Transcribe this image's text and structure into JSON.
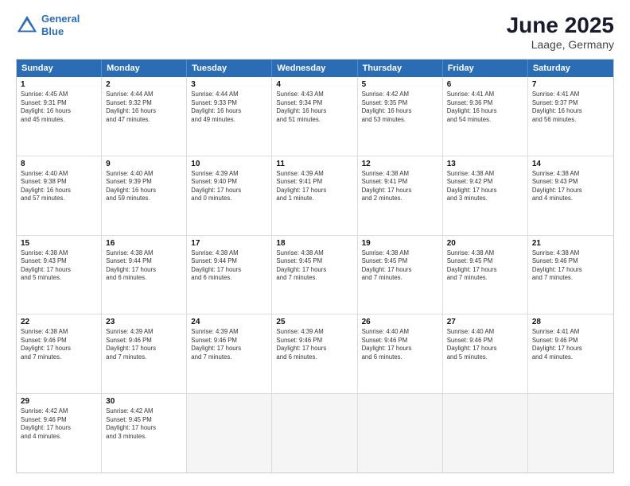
{
  "header": {
    "logo_line1": "General",
    "logo_line2": "Blue",
    "title": "June 2025",
    "location": "Laage, Germany"
  },
  "weekdays": [
    "Sunday",
    "Monday",
    "Tuesday",
    "Wednesday",
    "Thursday",
    "Friday",
    "Saturday"
  ],
  "rows": [
    [
      {
        "day": "1",
        "info": "Sunrise: 4:45 AM\nSunset: 9:31 PM\nDaylight: 16 hours\nand 45 minutes."
      },
      {
        "day": "2",
        "info": "Sunrise: 4:44 AM\nSunset: 9:32 PM\nDaylight: 16 hours\nand 47 minutes."
      },
      {
        "day": "3",
        "info": "Sunrise: 4:44 AM\nSunset: 9:33 PM\nDaylight: 16 hours\nand 49 minutes."
      },
      {
        "day": "4",
        "info": "Sunrise: 4:43 AM\nSunset: 9:34 PM\nDaylight: 16 hours\nand 51 minutes."
      },
      {
        "day": "5",
        "info": "Sunrise: 4:42 AM\nSunset: 9:35 PM\nDaylight: 16 hours\nand 53 minutes."
      },
      {
        "day": "6",
        "info": "Sunrise: 4:41 AM\nSunset: 9:36 PM\nDaylight: 16 hours\nand 54 minutes."
      },
      {
        "day": "7",
        "info": "Sunrise: 4:41 AM\nSunset: 9:37 PM\nDaylight: 16 hours\nand 56 minutes."
      }
    ],
    [
      {
        "day": "8",
        "info": "Sunrise: 4:40 AM\nSunset: 9:38 PM\nDaylight: 16 hours\nand 57 minutes."
      },
      {
        "day": "9",
        "info": "Sunrise: 4:40 AM\nSunset: 9:39 PM\nDaylight: 16 hours\nand 59 minutes."
      },
      {
        "day": "10",
        "info": "Sunrise: 4:39 AM\nSunset: 9:40 PM\nDaylight: 17 hours\nand 0 minutes."
      },
      {
        "day": "11",
        "info": "Sunrise: 4:39 AM\nSunset: 9:41 PM\nDaylight: 17 hours\nand 1 minute."
      },
      {
        "day": "12",
        "info": "Sunrise: 4:38 AM\nSunset: 9:41 PM\nDaylight: 17 hours\nand 2 minutes."
      },
      {
        "day": "13",
        "info": "Sunrise: 4:38 AM\nSunset: 9:42 PM\nDaylight: 17 hours\nand 3 minutes."
      },
      {
        "day": "14",
        "info": "Sunrise: 4:38 AM\nSunset: 9:43 PM\nDaylight: 17 hours\nand 4 minutes."
      }
    ],
    [
      {
        "day": "15",
        "info": "Sunrise: 4:38 AM\nSunset: 9:43 PM\nDaylight: 17 hours\nand 5 minutes."
      },
      {
        "day": "16",
        "info": "Sunrise: 4:38 AM\nSunset: 9:44 PM\nDaylight: 17 hours\nand 6 minutes."
      },
      {
        "day": "17",
        "info": "Sunrise: 4:38 AM\nSunset: 9:44 PM\nDaylight: 17 hours\nand 6 minutes."
      },
      {
        "day": "18",
        "info": "Sunrise: 4:38 AM\nSunset: 9:45 PM\nDaylight: 17 hours\nand 7 minutes."
      },
      {
        "day": "19",
        "info": "Sunrise: 4:38 AM\nSunset: 9:45 PM\nDaylight: 17 hours\nand 7 minutes."
      },
      {
        "day": "20",
        "info": "Sunrise: 4:38 AM\nSunset: 9:45 PM\nDaylight: 17 hours\nand 7 minutes."
      },
      {
        "day": "21",
        "info": "Sunrise: 4:38 AM\nSunset: 9:46 PM\nDaylight: 17 hours\nand 7 minutes."
      }
    ],
    [
      {
        "day": "22",
        "info": "Sunrise: 4:38 AM\nSunset: 9:46 PM\nDaylight: 17 hours\nand 7 minutes."
      },
      {
        "day": "23",
        "info": "Sunrise: 4:39 AM\nSunset: 9:46 PM\nDaylight: 17 hours\nand 7 minutes."
      },
      {
        "day": "24",
        "info": "Sunrise: 4:39 AM\nSunset: 9:46 PM\nDaylight: 17 hours\nand 7 minutes."
      },
      {
        "day": "25",
        "info": "Sunrise: 4:39 AM\nSunset: 9:46 PM\nDaylight: 17 hours\nand 6 minutes."
      },
      {
        "day": "26",
        "info": "Sunrise: 4:40 AM\nSunset: 9:46 PM\nDaylight: 17 hours\nand 6 minutes."
      },
      {
        "day": "27",
        "info": "Sunrise: 4:40 AM\nSunset: 9:46 PM\nDaylight: 17 hours\nand 5 minutes."
      },
      {
        "day": "28",
        "info": "Sunrise: 4:41 AM\nSunset: 9:46 PM\nDaylight: 17 hours\nand 4 minutes."
      }
    ],
    [
      {
        "day": "29",
        "info": "Sunrise: 4:42 AM\nSunset: 9:46 PM\nDaylight: 17 hours\nand 4 minutes."
      },
      {
        "day": "30",
        "info": "Sunrise: 4:42 AM\nSunset: 9:45 PM\nDaylight: 17 hours\nand 3 minutes."
      },
      {
        "day": "",
        "info": ""
      },
      {
        "day": "",
        "info": ""
      },
      {
        "day": "",
        "info": ""
      },
      {
        "day": "",
        "info": ""
      },
      {
        "day": "",
        "info": ""
      }
    ]
  ]
}
